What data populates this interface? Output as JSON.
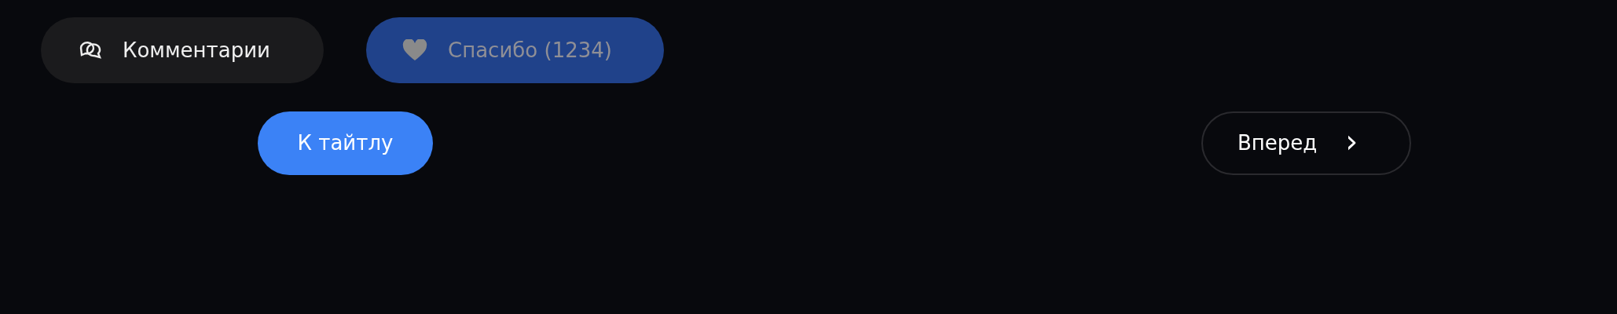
{
  "actions": [
    {
      "kind": "comments",
      "label": "Комментарии"
    },
    {
      "kind": "thanks",
      "label": "Спасибо (1234)",
      "liked": false
    }
  ],
  "navigation": {
    "back": {
      "label": "К тайтлу"
    },
    "next": {
      "label": "Вперед",
      "icon": "›"
    }
  }
}
